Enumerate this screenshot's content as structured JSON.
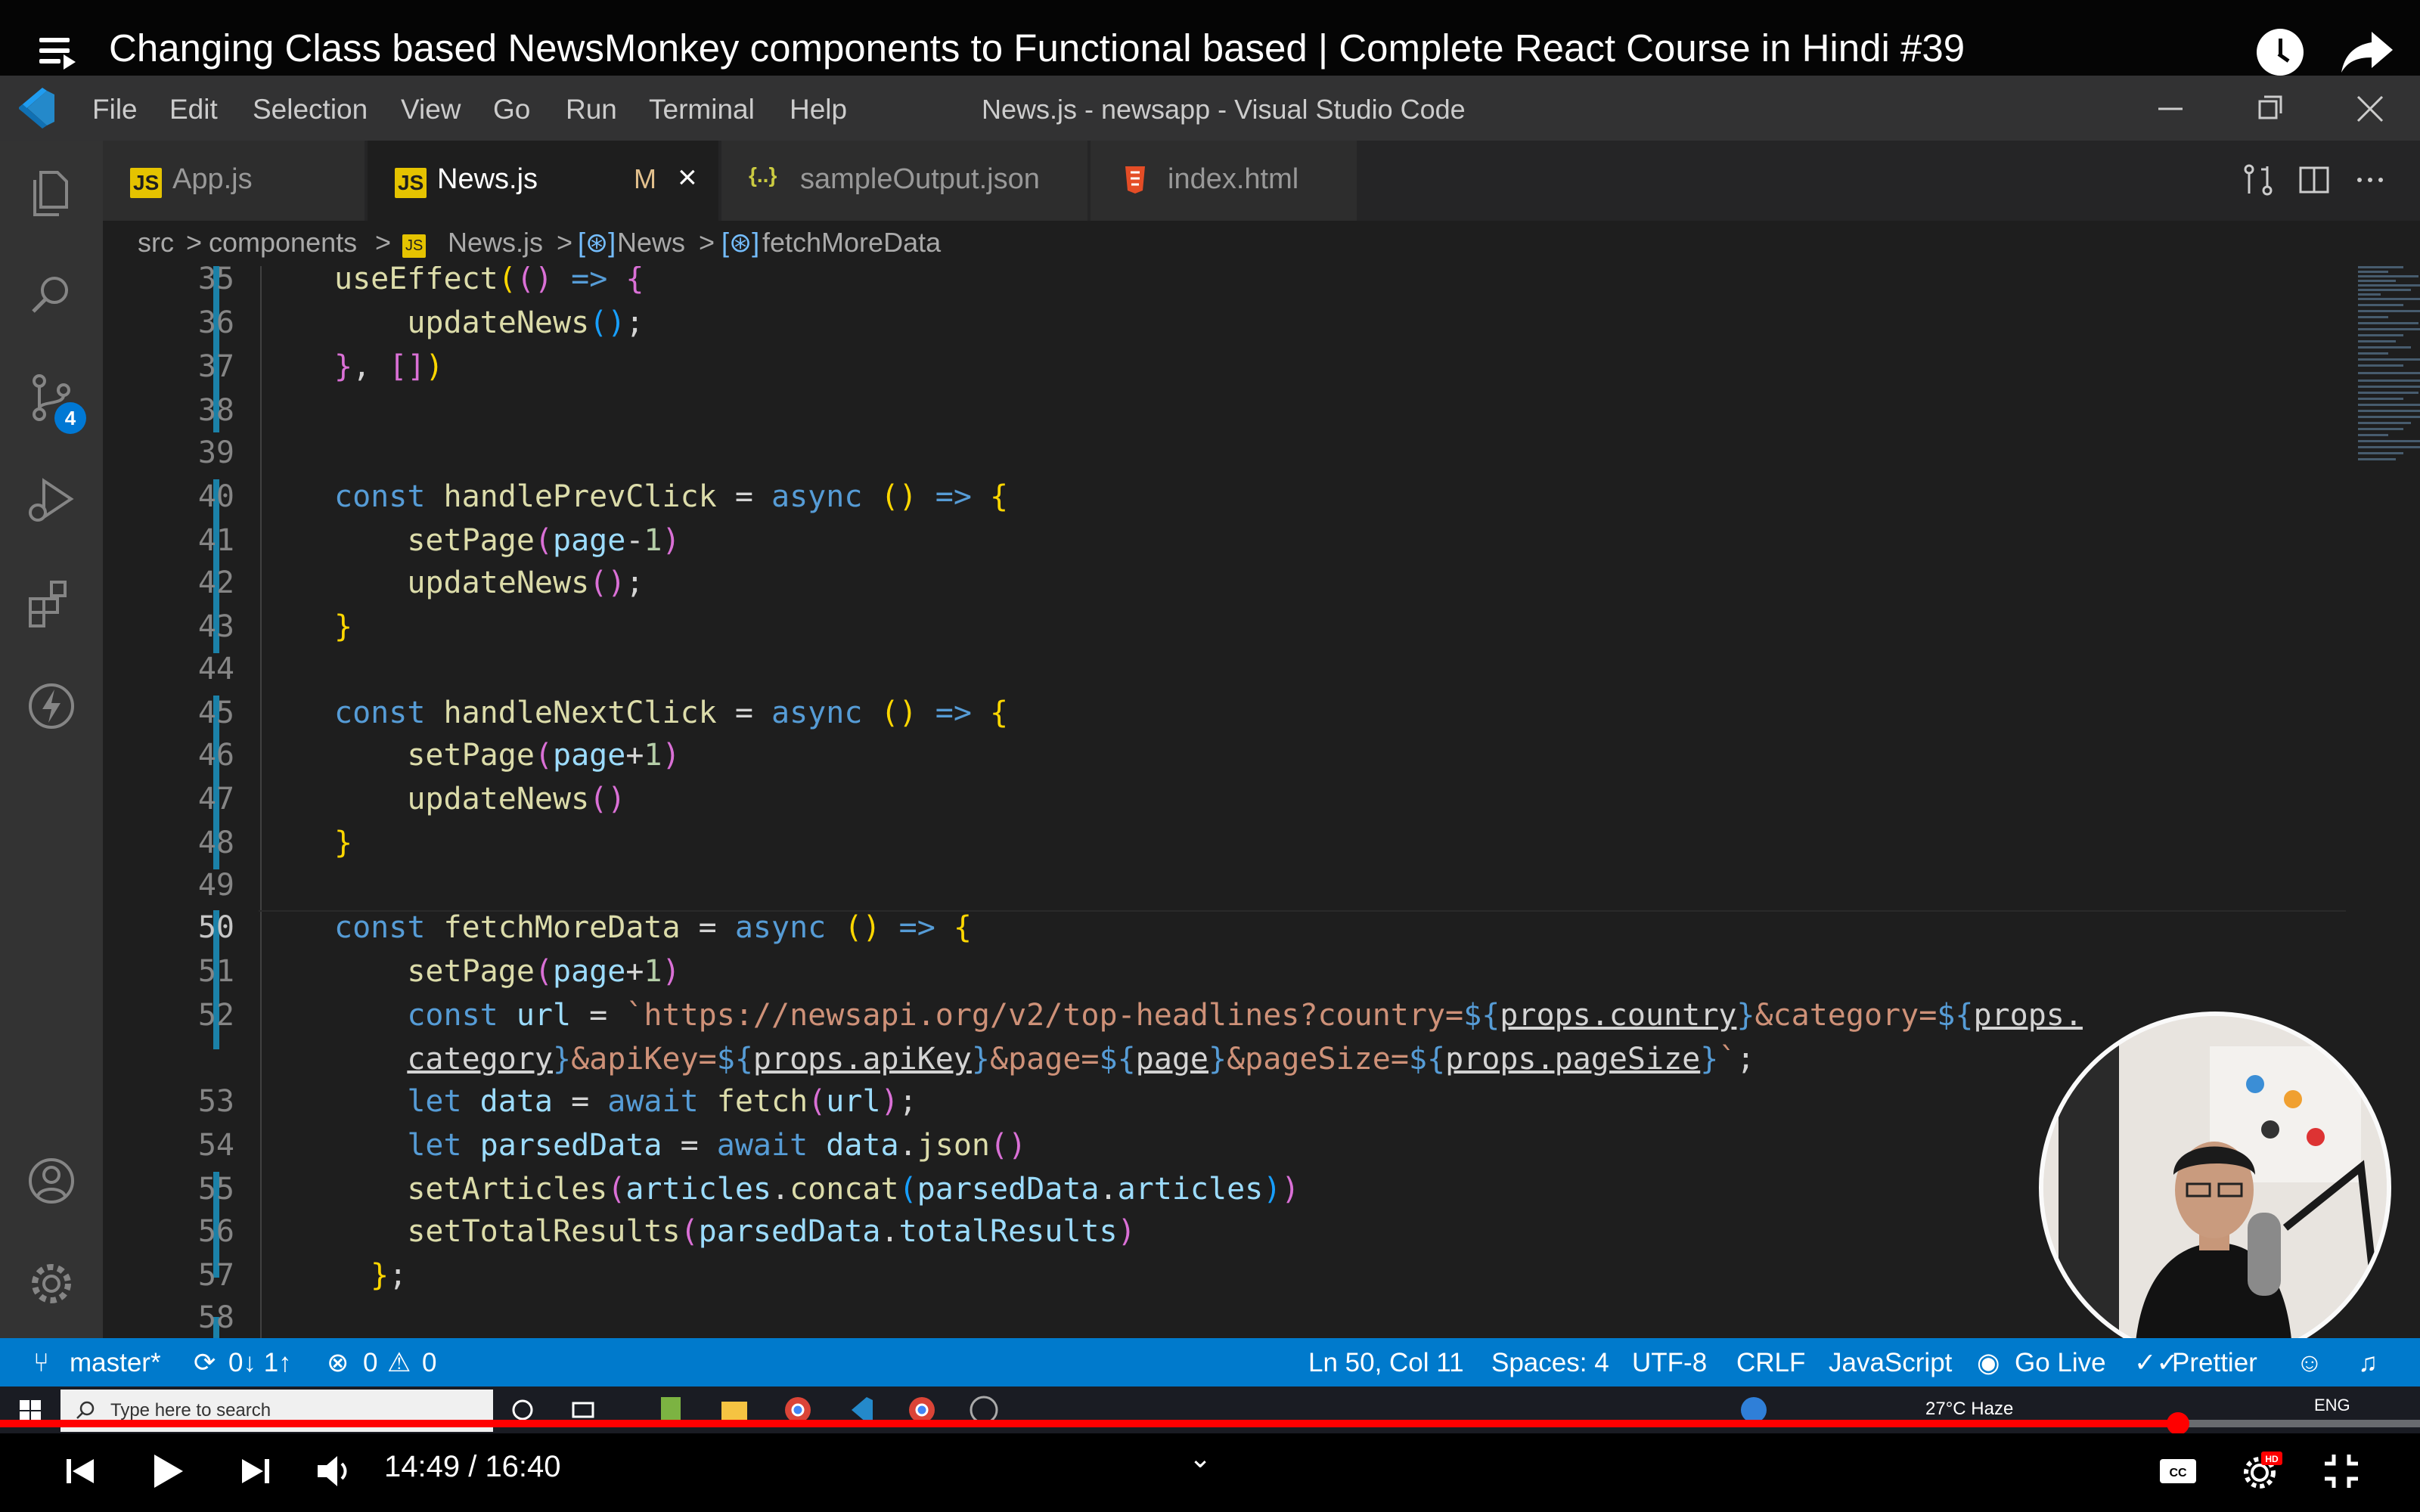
{
  "youtube": {
    "title": "Changing Class based NewsMonkey components to Functional based | Complete React Course in Hindi #39"
  },
  "vscode": {
    "menu": [
      "File",
      "Edit",
      "Selection",
      "View",
      "Go",
      "Run",
      "Terminal",
      "Help"
    ],
    "window_title": "News.js - newsapp - Visual Studio Code",
    "scm_badge": "4",
    "tabs": [
      {
        "icon": "JS",
        "label": "App.js",
        "active": false
      },
      {
        "icon": "JS",
        "label": "News.js",
        "modified": "M",
        "active": true
      },
      {
        "icon": "{..}",
        "label": "sampleOutput.json",
        "active": false
      },
      {
        "icon": "html",
        "label": "index.html",
        "active": false
      }
    ],
    "breadcrumb": {
      "src": "src",
      "components": "components",
      "file": "News.js",
      "symbol1": "News",
      "symbol2": "fetchMoreData",
      "sep": ">"
    },
    "line_numbers": [
      "35",
      "36",
      "37",
      "38",
      "39",
      "40",
      "41",
      "42",
      "43",
      "44",
      "45",
      "46",
      "47",
      "48",
      "49",
      "50",
      "51",
      "52",
      "53",
      "54",
      "55",
      "56",
      "57",
      "58"
    ],
    "current_line": "50"
  },
  "status_bar": {
    "branch": "master*",
    "sync": "0↓ 1↑",
    "errors": "0",
    "warnings": "0",
    "position": "Ln 50, Col 11",
    "spaces": "Spaces: 4",
    "encoding": "UTF-8",
    "eol": "CRLF",
    "language": "JavaScript",
    "go_live": "Go Live",
    "prettier": "Prettier"
  },
  "taskbar": {
    "search_placeholder": "Type here to search",
    "weather": "27°C  Haze",
    "lang": "ENG"
  },
  "player": {
    "time": "14:49 / 16:40",
    "progress": 0.9
  },
  "colors": {
    "vscode_blue": "#007acc",
    "youtube_red": "#ff0000",
    "js_yellow": "#e5c300"
  }
}
